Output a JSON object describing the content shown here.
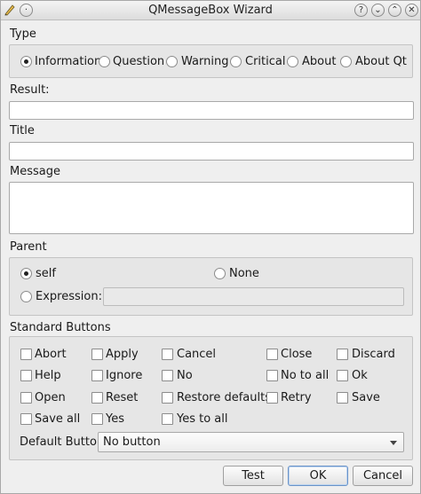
{
  "window": {
    "title": "QMessageBox Wizard"
  },
  "titlebar_icons": [
    "help-icon",
    "minimize-icon",
    "maximize-icon",
    "close-icon"
  ],
  "type_group": {
    "label": "Type",
    "options": [
      "Information",
      "Question",
      "Warning",
      "Critical",
      "About",
      "About Qt"
    ],
    "selected": "Information"
  },
  "result": {
    "label": "Result:",
    "value": ""
  },
  "title_field": {
    "label": "Title",
    "value": ""
  },
  "message_field": {
    "label": "Message",
    "value": ""
  },
  "parent_group": {
    "label": "Parent",
    "self_label": "self",
    "none_label": "None",
    "expression_label": "Expression:",
    "expression_value": "",
    "selected": "self"
  },
  "standard_buttons": {
    "label": "Standard Buttons",
    "items": [
      "Abort",
      "Apply",
      "Cancel",
      "Close",
      "Discard",
      "Help",
      "Ignore",
      "No",
      "No to all",
      "Ok",
      "Open",
      "Reset",
      "Restore defaults",
      "Retry",
      "Save",
      "Save all",
      "Yes",
      "Yes to all"
    ],
    "default_button_label": "Default Button:",
    "default_button_value": "No button"
  },
  "actions": {
    "test": "Test",
    "ok": "OK",
    "cancel": "Cancel"
  }
}
